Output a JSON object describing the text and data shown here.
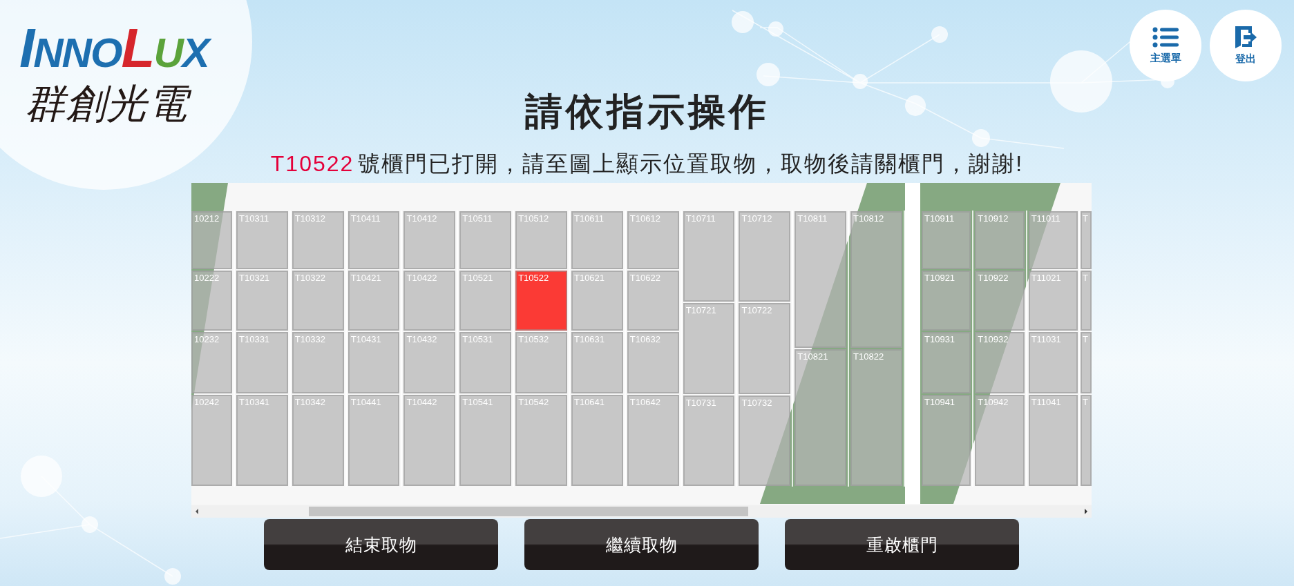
{
  "logo": {
    "wordmark": "INNOLUX",
    "name": "群創光電"
  },
  "top_buttons": [
    {
      "kind": "menu",
      "label": "主選單"
    },
    {
      "kind": "logout",
      "label": "登出"
    }
  ],
  "title": "請依指示操作",
  "message": {
    "locker_code": "T10522",
    "text": "號櫃門已打開，請至圖上顯示位置取物，取物後請關櫃門，謝謝!"
  },
  "locker_map": {
    "sections": [
      {
        "columns": [
          {
            "cells": [
              {
                "label": "10212",
                "selected": false
              },
              {
                "label": "10222",
                "selected": false
              },
              {
                "label": "10232",
                "selected": false
              },
              {
                "label": "10242",
                "selected": false
              }
            ]
          },
          {
            "cells": [
              {
                "label": "T10311",
                "selected": false
              },
              {
                "label": "T10321",
                "selected": false
              },
              {
                "label": "T10331",
                "selected": false
              },
              {
                "label": "T10341",
                "selected": false
              }
            ]
          },
          {
            "cells": [
              {
                "label": "T10312",
                "selected": false
              },
              {
                "label": "T10322",
                "selected": false
              },
              {
                "label": "T10332",
                "selected": false
              },
              {
                "label": "T10342",
                "selected": false
              }
            ]
          },
          {
            "cells": [
              {
                "label": "T10411",
                "selected": false
              },
              {
                "label": "T10421",
                "selected": false
              },
              {
                "label": "T10431",
                "selected": false
              },
              {
                "label": "T10441",
                "selected": false
              }
            ]
          },
          {
            "cells": [
              {
                "label": "T10412",
                "selected": false
              },
              {
                "label": "T10422",
                "selected": false
              },
              {
                "label": "T10432",
                "selected": false
              },
              {
                "label": "T10442",
                "selected": false
              }
            ]
          },
          {
            "cells": [
              {
                "label": "T10511",
                "selected": false
              },
              {
                "label": "T10521",
                "selected": false
              },
              {
                "label": "T10531",
                "selected": false
              },
              {
                "label": "T10541",
                "selected": false
              }
            ]
          },
          {
            "cells": [
              {
                "label": "T10512",
                "selected": false
              },
              {
                "label": "T10522",
                "selected": true
              },
              {
                "label": "T10532",
                "selected": false
              },
              {
                "label": "T10542",
                "selected": false
              }
            ]
          },
          {
            "cells": [
              {
                "label": "T10611",
                "selected": false
              },
              {
                "label": "T10621",
                "selected": false
              },
              {
                "label": "T10631",
                "selected": false
              },
              {
                "label": "T10641",
                "selected": false
              }
            ]
          },
          {
            "cells": [
              {
                "label": "T10612",
                "selected": false
              },
              {
                "label": "T10622",
                "selected": false
              },
              {
                "label": "T10632",
                "selected": false
              },
              {
                "label": "T10642",
                "selected": false
              }
            ]
          },
          {
            "cells": [
              {
                "label": "T10711",
                "selected": false
              },
              {
                "label": "T10721",
                "selected": false
              },
              {
                "label": "T10731",
                "selected": false
              }
            ]
          },
          {
            "cells": [
              {
                "label": "T10712",
                "selected": false
              },
              {
                "label": "T10722",
                "selected": false
              },
              {
                "label": "T10732",
                "selected": false
              }
            ]
          },
          {
            "cells": [
              {
                "label": "T10811",
                "selected": false
              },
              {
                "label": "T10821",
                "selected": false
              }
            ]
          },
          {
            "cells": [
              {
                "label": "T10812",
                "selected": false
              },
              {
                "label": "T10822",
                "selected": false
              }
            ]
          }
        ]
      },
      {
        "columns": [
          {
            "cells": [
              {
                "label": "T10911",
                "selected": false
              },
              {
                "label": "T10921",
                "selected": false
              },
              {
                "label": "T10931",
                "selected": false
              },
              {
                "label": "T10941",
                "selected": false
              }
            ]
          },
          {
            "cells": [
              {
                "label": "T10912",
                "selected": false
              },
              {
                "label": "T10922",
                "selected": false
              },
              {
                "label": "T10932",
                "selected": false
              },
              {
                "label": "T10942",
                "selected": false
              }
            ]
          },
          {
            "cells": [
              {
                "label": "T11011",
                "selected": false
              },
              {
                "label": "T11021",
                "selected": false
              },
              {
                "label": "T11031",
                "selected": false
              },
              {
                "label": "T11041",
                "selected": false
              }
            ]
          },
          {
            "cells": [
              {
                "label": "T",
                "selected": false
              },
              {
                "label": "T",
                "selected": false
              },
              {
                "label": "T",
                "selected": false
              },
              {
                "label": "T",
                "selected": false
              }
            ]
          }
        ]
      }
    ]
  },
  "buttons": [
    "結束取物",
    "繼續取物",
    "重啟櫃門"
  ]
}
